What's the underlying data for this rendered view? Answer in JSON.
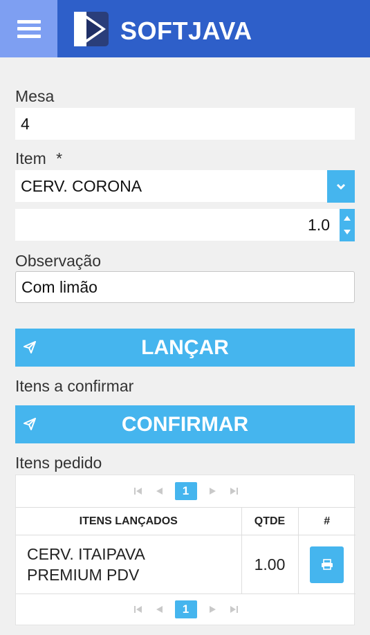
{
  "header": {
    "brand": "SOFTJAVA",
    "menu_icon": "hamburger-icon",
    "logo_icon": "play-triangle-logo",
    "colors": {
      "bar": "#2e5fc9",
      "menu": "#7e9ff2",
      "accent": "#45b5ee"
    }
  },
  "form": {
    "mesa": {
      "label": "Mesa",
      "value": "4"
    },
    "item": {
      "label": "Item",
      "required_mark": "*",
      "value": "CERV. CORONA"
    },
    "quantity": {
      "value": "1.0"
    },
    "observacao": {
      "label": "Observação",
      "value": "Com limão"
    }
  },
  "actions": {
    "lancar": "LANÇAR",
    "itens_a_confirmar": "Itens a confirmar",
    "confirmar": "CONFIRMAR"
  },
  "orders": {
    "title": "Itens pedido",
    "current_page": "1",
    "columns": [
      "ITENS LANÇADOS",
      "QTDE",
      "#"
    ],
    "rows": [
      {
        "item_line1": "CERV. ITAIPAVA",
        "item_line2": "PREMIUM PDV",
        "qtde": "1.00",
        "action_icon": "print-icon"
      }
    ]
  }
}
